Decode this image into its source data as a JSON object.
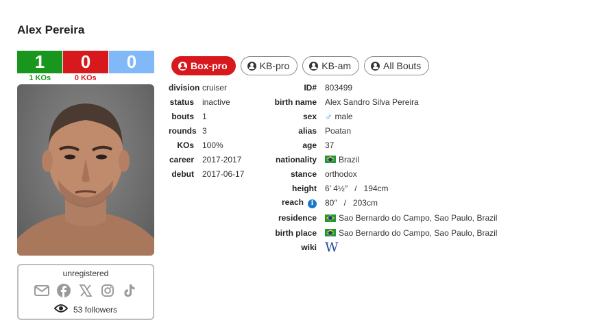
{
  "name": "Alex Pereira",
  "record": {
    "wins": "1",
    "losses": "0",
    "draws": "0",
    "win_kos": "1 KOs",
    "loss_kos": "0 KOs"
  },
  "photo": {
    "alt": "fighter photo"
  },
  "social": {
    "status": "unregistered",
    "followers": "53 followers",
    "icons": [
      "mail-icon",
      "facebook-icon",
      "x-icon",
      "instagram-icon",
      "tiktok-icon"
    ]
  },
  "tabs": [
    {
      "label": "Box-pro",
      "active": true
    },
    {
      "label": "KB-pro",
      "active": false
    },
    {
      "label": "KB-am",
      "active": false
    },
    {
      "label": "All Bouts",
      "active": false
    }
  ],
  "info_left": [
    {
      "label": "division",
      "value": "cruiser"
    },
    {
      "label": "status",
      "value": "inactive"
    },
    {
      "label": "bouts",
      "value": "1"
    },
    {
      "label": "rounds",
      "value": "3"
    },
    {
      "label": "KOs",
      "value": "100%"
    },
    {
      "label": "career",
      "value": "2017-2017"
    },
    {
      "label": "debut",
      "value": "2017-06-17"
    }
  ],
  "info_right": {
    "id_label": "ID#",
    "id_value": "803499",
    "birth_name_label": "birth name",
    "birth_name_value": "Alex Sandro Silva Pereira",
    "sex_label": "sex",
    "sex_symbol": "♂",
    "sex_value": "male",
    "alias_label": "alias",
    "alias_value": "Poatan",
    "age_label": "age",
    "age_value": "37",
    "nationality_label": "nationality",
    "nationality_value": "Brazil",
    "stance_label": "stance",
    "stance_value": "orthodox",
    "height_label": "height",
    "height_value": "6′ 4½″   /   194cm",
    "reach_label": "reach",
    "reach_value": "80″   /   203cm",
    "residence_label": "residence",
    "residence_value": "Sao Bernardo do Campo, Sao Paulo, Brazil",
    "birth_place_label": "birth place",
    "birth_place_value": "Sao Bernardo do Campo, Sao Paulo, Brazil",
    "wiki_label": "wiki",
    "wiki_symbol": "W"
  },
  "colors": {
    "win": "#18961e",
    "loss": "#d7181c",
    "draw": "#80b8f8",
    "active_tab": "#d7181c"
  }
}
